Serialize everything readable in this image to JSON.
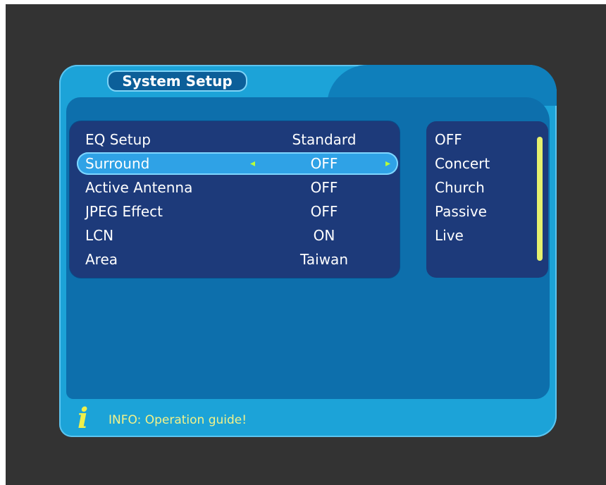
{
  "menu": {
    "title": "System Setup",
    "rows": [
      {
        "label": "EQ Setup",
        "value": "Standard"
      },
      {
        "label": "Surround",
        "value": "OFF"
      },
      {
        "label": "Active Antenna",
        "value": "OFF"
      },
      {
        "label": "JPEG Effect",
        "value": "OFF"
      },
      {
        "label": "LCN",
        "value": "ON"
      },
      {
        "label": "Area",
        "value": "Taiwan"
      }
    ],
    "selected_row_label": "Surround",
    "left_arrow_glyph": "◂",
    "right_arrow_glyph": "▸"
  },
  "options": {
    "items": [
      "OFF",
      "Concert",
      "Church",
      "Passive",
      "Live"
    ]
  },
  "info": {
    "icon": "i",
    "text": "INFO: Operation guide!"
  },
  "colors": {
    "frame": "#1ca3d8",
    "panel": "#1d3a7a",
    "selected": "#2fa2e6",
    "info_text": "#f2f28a",
    "scrollbar": "#e6f06e"
  }
}
